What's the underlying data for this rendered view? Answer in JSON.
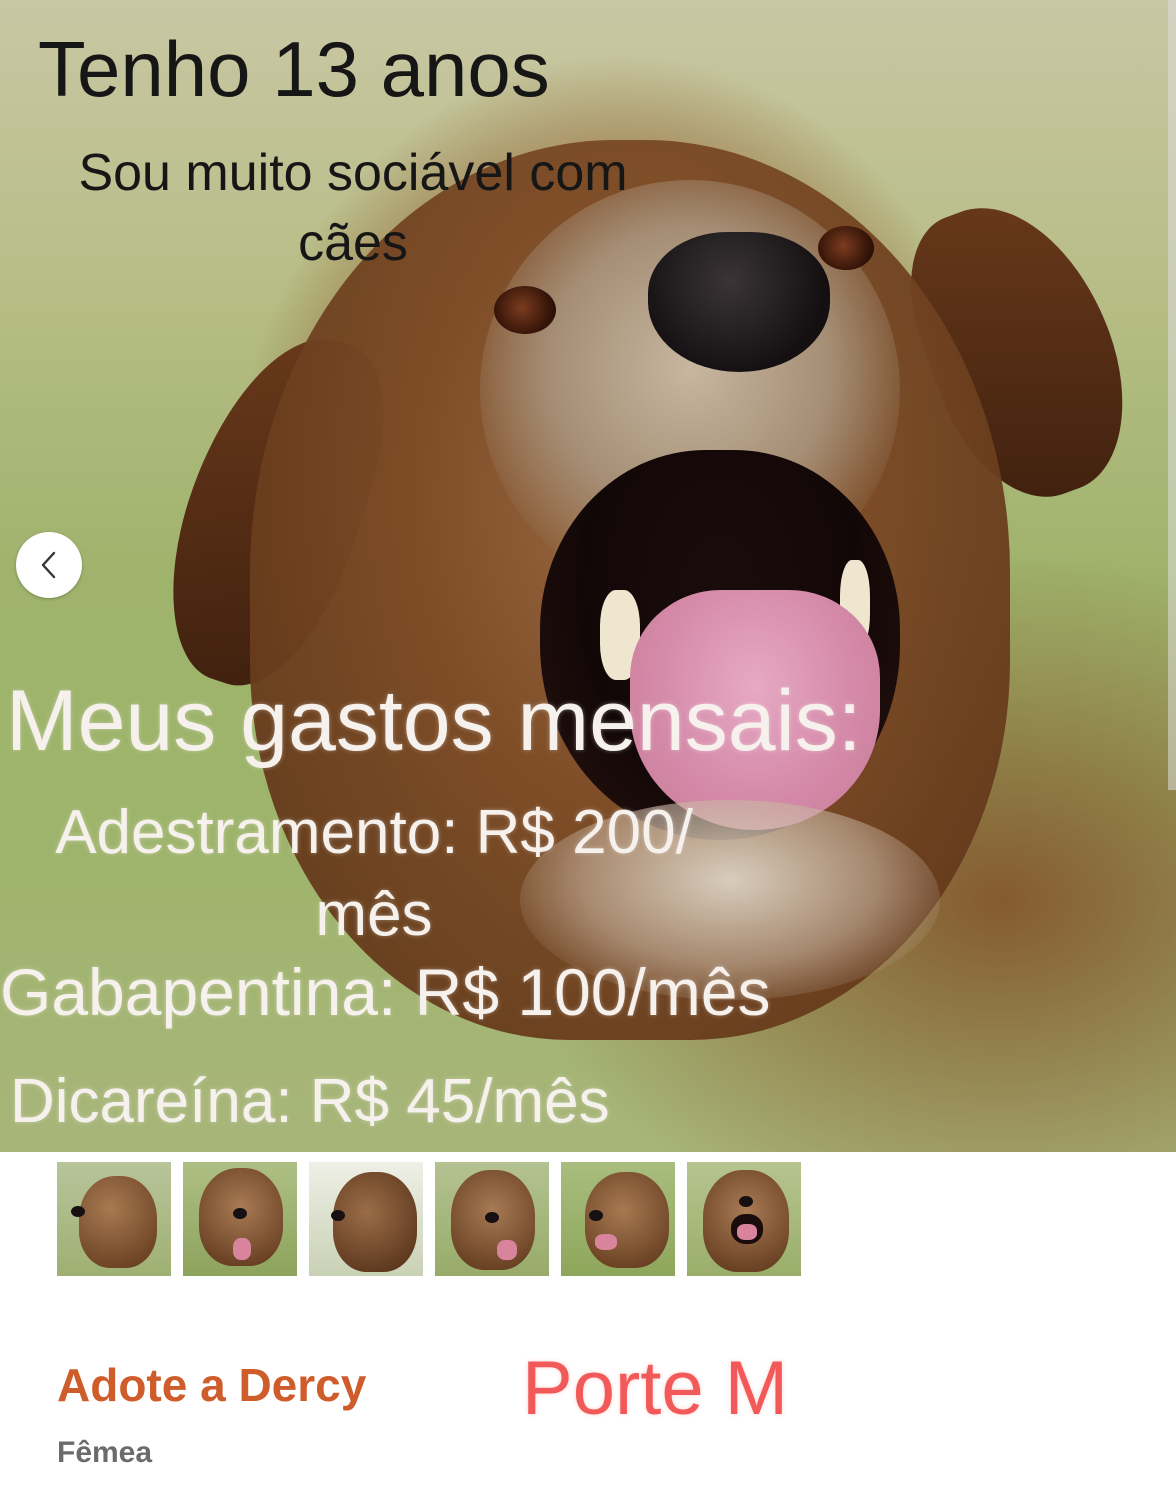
{
  "hero": {
    "age_text": "Tenho 13 anos",
    "social_text": "Sou muito sociável com cães",
    "expenses_title": "Meus gastos mensais:",
    "expenses": [
      {
        "text": "Adestramento: R$ 200/ mês"
      },
      {
        "text": "Gabapentina: R$ 100/mês"
      },
      {
        "text": "Dicareína: R$ 45/mês"
      }
    ],
    "prev_icon": "chevron-left-icon"
  },
  "thumbnails": [
    {
      "label": "dog-photo-1"
    },
    {
      "label": "dog-photo-2"
    },
    {
      "label": "dog-photo-3"
    },
    {
      "label": "dog-photo-4"
    },
    {
      "label": "dog-photo-5"
    },
    {
      "label": "dog-photo-6"
    }
  ],
  "info": {
    "title": "Adote a Dercy",
    "size": "Porte M",
    "sex": "Fêmea"
  },
  "colors": {
    "title": "#cf5c2b",
    "size": "#f25a5a",
    "sex": "#6b6b6b"
  }
}
